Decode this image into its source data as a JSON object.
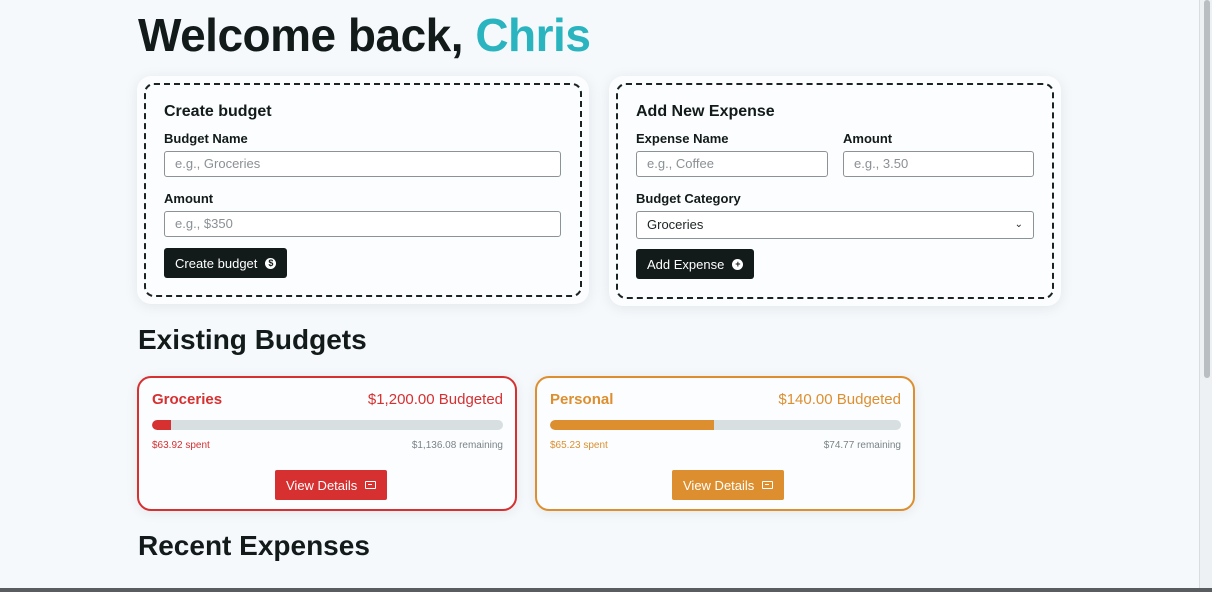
{
  "header": {
    "greeting": "Welcome back,",
    "user_name": "Chris"
  },
  "create_budget": {
    "title": "Create budget",
    "name_label": "Budget Name",
    "name_placeholder": "e.g., Groceries",
    "amount_label": "Amount",
    "amount_placeholder": "e.g., $350",
    "button_label": "Create budget",
    "button_icon": "dollar-circle-icon"
  },
  "add_expense": {
    "title": "Add New Expense",
    "name_label": "Expense Name",
    "name_placeholder": "e.g., Coffee",
    "amount_label": "Amount",
    "amount_placeholder": "e.g., 3.50",
    "category_label": "Budget Category",
    "category_selected": "Groceries",
    "button_label": "Add Expense",
    "button_icon": "plus-circle-icon"
  },
  "existing_budgets": {
    "title": "Existing Budgets",
    "items": [
      {
        "name": "Groceries",
        "budgeted": "$1,200.00 Budgeted",
        "spent": "$63.92 spent",
        "remaining": "$1,136.08 remaining",
        "progress_fraction": 0.053,
        "color": "#d63031",
        "button_label": "View Details"
      },
      {
        "name": "Personal",
        "budgeted": "$140.00 Budgeted",
        "spent": "$65.23 spent",
        "remaining": "$74.77 remaining",
        "progress_fraction": 0.466,
        "color": "#dd8f2f",
        "button_label": "View Details"
      }
    ]
  },
  "recent_expenses": {
    "title": "Recent Expenses"
  }
}
